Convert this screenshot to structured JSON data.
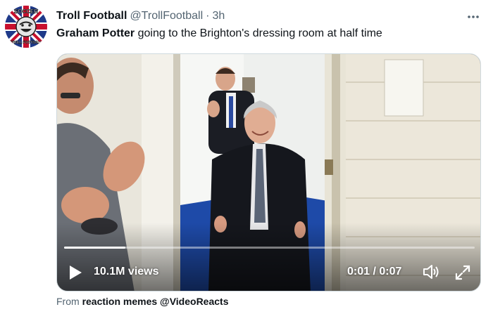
{
  "tweet": {
    "display_name": "Troll Football",
    "handle": "@TrollFootball",
    "separator": "·",
    "time": "3h",
    "text_bold": "Graham Potter",
    "text_rest": " going to the Brighton's dressing room at half time"
  },
  "avatar": {
    "top_text": "SOCCER",
    "bottom_text": "TROLL FOOTBALL"
  },
  "video": {
    "views": "10.1M views",
    "time_display": "0:01 / 0:07",
    "progress_fraction": 0.15
  },
  "attribution": {
    "prefix": "From",
    "source": "reaction memes @VideoReacts"
  },
  "colors": {
    "text_primary": "#0f1419",
    "text_secondary": "#536471",
    "video_overlay_text": "#ffffff"
  },
  "icons": {
    "more": "more-horizontal-icon",
    "play": "play-icon",
    "volume": "volume-icon",
    "fullscreen": "fullscreen-icon"
  }
}
